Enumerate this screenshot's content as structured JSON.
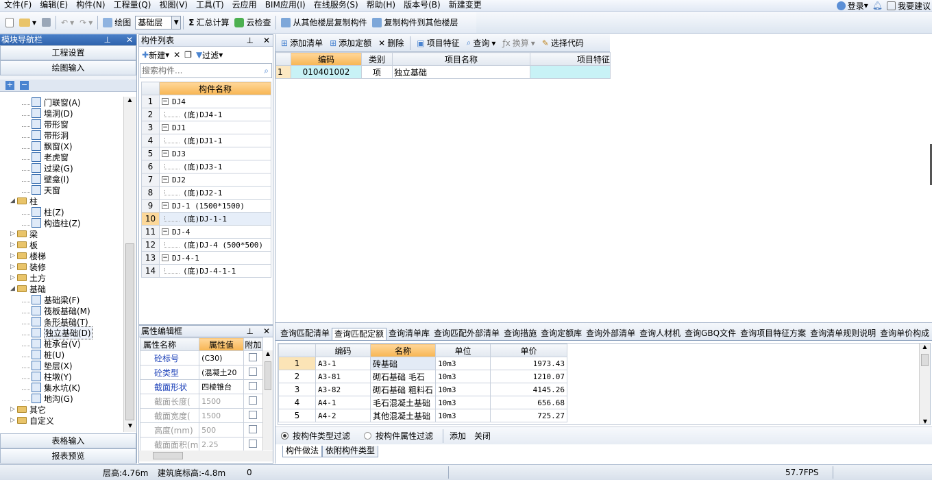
{
  "menu": [
    "文件(F)",
    "编辑(E)",
    "构件(N)",
    "工程量(Q)",
    "视图(V)",
    "工具(T)",
    "云应用",
    "BIM应用(I)",
    "在线服务(S)",
    "帮助(H)",
    "版本号(B)",
    "新建变更"
  ],
  "menu_right": {
    "login": "登录",
    "suggest": "我要建议"
  },
  "toolbar": {
    "draw": "绘图",
    "layer": "基础层",
    "sum": "汇总计算",
    "cloud_check": "云检查",
    "copy_from": "从其他楼层复制构件",
    "copy_to": "复制构件到其他楼层"
  },
  "nav": {
    "title": "模块导航栏",
    "btn_project": "工程设置",
    "btn_draw": "绘图输入",
    "btn_table": "表格输入",
    "btn_report": "报表预览",
    "tree": [
      {
        "label": "门联窗(A)",
        "level": 2,
        "type": "leaf"
      },
      {
        "label": "墙洞(D)",
        "level": 2,
        "type": "leaf"
      },
      {
        "label": "带形窗",
        "level": 2,
        "type": "leaf"
      },
      {
        "label": "带形洞",
        "level": 2,
        "type": "leaf"
      },
      {
        "label": "飘窗(X)",
        "level": 2,
        "type": "leaf"
      },
      {
        "label": "老虎窗",
        "level": 2,
        "type": "leaf"
      },
      {
        "label": "过梁(G)",
        "level": 2,
        "type": "leaf"
      },
      {
        "label": "壁龛(I)",
        "level": 2,
        "type": "leaf"
      },
      {
        "label": "天窗",
        "level": 2,
        "type": "leaf"
      },
      {
        "label": "柱",
        "level": 1,
        "type": "folder",
        "open": true
      },
      {
        "label": "柱(Z)",
        "level": 2,
        "type": "leaf"
      },
      {
        "label": "构造柱(Z)",
        "level": 2,
        "type": "leaf"
      },
      {
        "label": "梁",
        "level": 1,
        "type": "folder"
      },
      {
        "label": "板",
        "level": 1,
        "type": "folder"
      },
      {
        "label": "楼梯",
        "level": 1,
        "type": "folder"
      },
      {
        "label": "装修",
        "level": 1,
        "type": "folder"
      },
      {
        "label": "土方",
        "level": 1,
        "type": "folder"
      },
      {
        "label": "基础",
        "level": 1,
        "type": "folder",
        "open": true
      },
      {
        "label": "基础梁(F)",
        "level": 2,
        "type": "leaf"
      },
      {
        "label": "筏板基础(M)",
        "level": 2,
        "type": "leaf"
      },
      {
        "label": "条形基础(T)",
        "level": 2,
        "type": "leaf"
      },
      {
        "label": "独立基础(D)",
        "level": 2,
        "type": "leaf",
        "selected": true
      },
      {
        "label": "桩承台(V)",
        "level": 2,
        "type": "leaf"
      },
      {
        "label": "桩(U)",
        "level": 2,
        "type": "leaf"
      },
      {
        "label": "垫层(X)",
        "level": 2,
        "type": "leaf"
      },
      {
        "label": "柱墩(Y)",
        "level": 2,
        "type": "leaf"
      },
      {
        "label": "集水坑(K)",
        "level": 2,
        "type": "leaf"
      },
      {
        "label": "地沟(G)",
        "level": 2,
        "type": "leaf"
      },
      {
        "label": "其它",
        "level": 1,
        "type": "folder"
      },
      {
        "label": "自定义",
        "level": 1,
        "type": "folder"
      }
    ]
  },
  "component_list": {
    "title": "构件列表",
    "new": "新建",
    "filter": "过滤",
    "search_placeholder": "搜索构件...",
    "header": "构件名称",
    "rows": [
      {
        "n": "1",
        "name": "DJ4",
        "child": false
      },
      {
        "n": "2",
        "name": "(底)DJ4-1",
        "child": true
      },
      {
        "n": "3",
        "name": "DJ1",
        "child": false
      },
      {
        "n": "4",
        "name": "(底)DJ1-1",
        "child": true
      },
      {
        "n": "5",
        "name": "DJ3",
        "child": false
      },
      {
        "n": "6",
        "name": "(底)DJ3-1",
        "child": true
      },
      {
        "n": "7",
        "name": "DJ2",
        "child": false
      },
      {
        "n": "8",
        "name": "(底)DJ2-1",
        "child": true
      },
      {
        "n": "9",
        "name": "DJ-1 (1500*1500)",
        "child": false
      },
      {
        "n": "10",
        "name": "(底)DJ-1-1",
        "child": true,
        "selected": true
      },
      {
        "n": "11",
        "name": "DJ-4",
        "child": false
      },
      {
        "n": "12",
        "name": "(底)DJ-4 (500*500)",
        "child": true
      },
      {
        "n": "13",
        "name": "DJ-4-1",
        "child": false
      },
      {
        "n": "14",
        "name": "(底)DJ-4-1-1",
        "child": true
      }
    ]
  },
  "property": {
    "title": "属性编辑框",
    "h_name": "属性名称",
    "h_value": "属性值",
    "h_add": "附加",
    "rows": [
      {
        "name": "砼标号",
        "value": "(C30)",
        "blue": true
      },
      {
        "name": "砼类型",
        "value": "(混凝土20",
        "blue": true
      },
      {
        "name": "截面形状",
        "value": "四棱锥台",
        "blue": true
      },
      {
        "name": "截面长度(",
        "value": "1500",
        "blue": false
      },
      {
        "name": "截面宽度(",
        "value": "1500",
        "blue": false
      },
      {
        "name": "高度(mm)",
        "value": "500",
        "blue": false
      },
      {
        "name": "截面面积(m",
        "value": "2.25",
        "blue": false
      }
    ]
  },
  "quota_toolbar": {
    "add_list": "添加清单",
    "add_quota": "添加定额",
    "delete": "删除",
    "features": "项目特征",
    "query": "查询",
    "convert": "换算",
    "select_code": "选择代码"
  },
  "quota_table": {
    "headers": [
      "编码",
      "类别",
      "项目名称",
      "项目特征"
    ],
    "rows": [
      {
        "n": "1",
        "code": "010401002",
        "type": "项",
        "name": "独立基础",
        "feature": ""
      }
    ]
  },
  "bottom_tabs": [
    "查询匹配清单",
    "查询匹配定额",
    "查询清单库",
    "查询匹配外部清单",
    "查询措施",
    "查询定额库",
    "查询外部清单",
    "查询人材机",
    "查询GBQ文件",
    "查询项目特征方案",
    "查询清单规则说明",
    "查询单价构成"
  ],
  "bottom_table": {
    "headers": [
      "编码",
      "名称",
      "单位",
      "单价"
    ],
    "rows": [
      {
        "n": "1",
        "code": "A3-1",
        "name": "砖基础",
        "unit": "10m3",
        "price": "1973.43"
      },
      {
        "n": "2",
        "code": "A3-81",
        "name": "砌石基础 毛石",
        "unit": "10m3",
        "price": "1210.07"
      },
      {
        "n": "3",
        "code": "A3-82",
        "name": "砌石基础 粗料石",
        "unit": "10m3",
        "price": "4145.26"
      },
      {
        "n": "4",
        "code": "A4-1",
        "name": "毛石混凝土基础",
        "unit": "10m3",
        "price": "656.68"
      },
      {
        "n": "5",
        "code": "A4-2",
        "name": "其他混凝土基础",
        "unit": "10m3",
        "price": "725.27"
      }
    ]
  },
  "filter_bar": {
    "by_type": "按构件类型过滤",
    "by_attr": "按构件属性过滤",
    "add": "添加",
    "close": "关闭"
  },
  "sub_tabs": [
    "构件做法",
    "依附构件类型"
  ],
  "status": {
    "floor_height": "层高:4.76m",
    "base_elev": "建筑底标高:-4.8m",
    "zero": "0",
    "fps": "57.7FPS"
  }
}
